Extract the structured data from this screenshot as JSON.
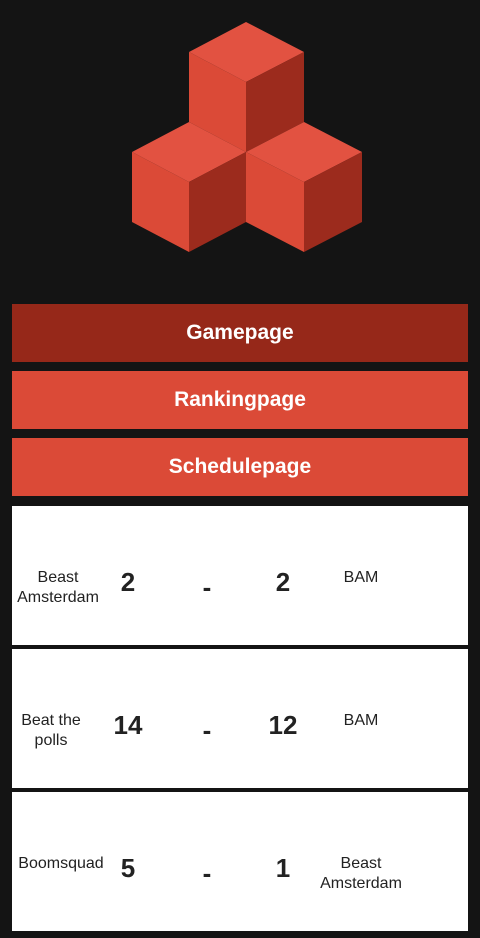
{
  "colors": {
    "background": "#141414",
    "accent": "#db4a37",
    "accent_dark": "#962819",
    "card": "#ffffff"
  },
  "logo": {
    "icon": "cubes-logo-icon"
  },
  "nav": [
    {
      "label": "Gamepage",
      "active": true
    },
    {
      "label": "Rankingpage",
      "active": false
    },
    {
      "label": "Schedulepage",
      "active": false
    }
  ],
  "matches": [
    {
      "home": "Beast Amsterdam",
      "home_score": "2",
      "separator": "-",
      "away_score": "2",
      "away": "BAM"
    },
    {
      "home": "Beat the polls",
      "home_score": "14",
      "separator": "-",
      "away_score": "12",
      "away": "BAM"
    },
    {
      "home": "Boomsquad",
      "home_score": "5",
      "separator": "-",
      "away_score": "1",
      "away": "Beast Amsterdam"
    }
  ]
}
